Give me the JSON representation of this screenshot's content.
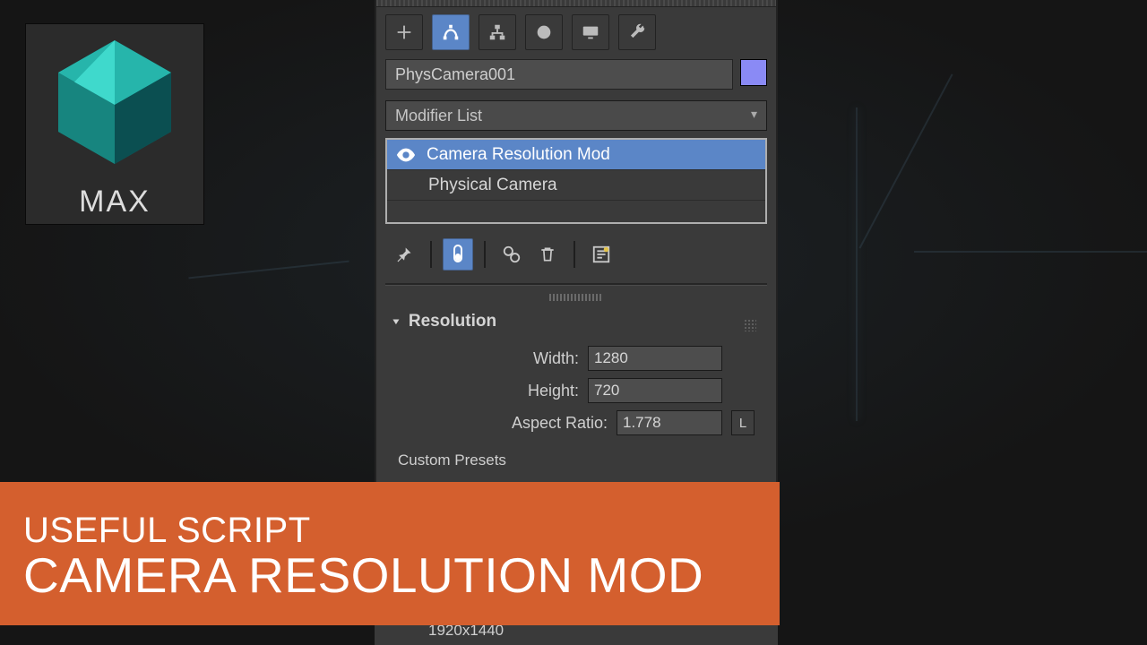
{
  "logo": {
    "label": "MAX"
  },
  "panel": {
    "object_name": "PhysCamera001",
    "modifier_list_label": "Modifier List",
    "stack": {
      "items": [
        {
          "label": "Camera Resolution Mod",
          "selected": true
        },
        {
          "label": "Physical Camera",
          "selected": false
        }
      ]
    },
    "rollout": {
      "title": "Resolution",
      "width_label": "Width:",
      "height_label": "Height:",
      "aspect_label": "Aspect Ratio:",
      "width_value": "1280",
      "height_value": "720",
      "aspect_value": "1.778",
      "lock_label": "L",
      "presets_label": "Custom Presets"
    },
    "visible_preset": "1920x1440"
  },
  "banner": {
    "line1": "USEFUL SCRIPT",
    "line2": "CAMERA RESOLUTION MOD"
  }
}
